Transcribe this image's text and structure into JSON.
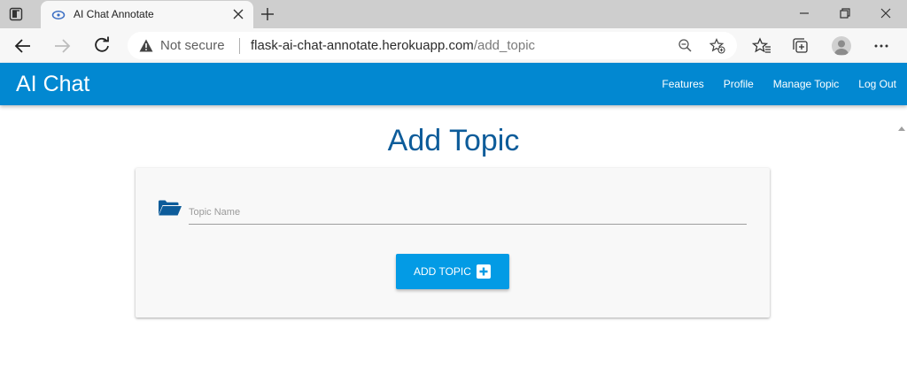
{
  "browser": {
    "tab": {
      "title": "AI Chat Annotate"
    },
    "address": {
      "security_label": "Not secure",
      "url_host": "flask-ai-chat-annotate.herokuapp.com",
      "url_path": "/add_topic"
    }
  },
  "header": {
    "brand": "AI Chat",
    "nav": [
      {
        "label": "Features"
      },
      {
        "label": "Profile"
      },
      {
        "label": "Manage Topic"
      },
      {
        "label": "Log Out"
      }
    ]
  },
  "main": {
    "title": "Add Topic",
    "form": {
      "topic_name": {
        "placeholder": "Topic Name",
        "value": ""
      },
      "submit_label": "ADD TOPIC"
    }
  },
  "colors": {
    "header": "#0288d1",
    "title": "#0d5c9a",
    "button": "#039be5",
    "folder_icon": "#0d5c9a"
  },
  "icons": {
    "tab_actions": "tab-actions-icon",
    "favicon": "chat-favicon-icon",
    "tab_close": "close-icon",
    "new_tab": "plus-icon",
    "minimize": "minimize-icon",
    "restore": "restore-icon",
    "close_window": "close-icon",
    "back": "back-arrow-icon",
    "forward": "forward-arrow-icon",
    "refresh": "refresh-icon",
    "warning": "warning-icon",
    "zoom": "zoom-out-icon",
    "add_favorite": "add-favorite-icon",
    "favorites": "favorites-icon",
    "collections": "collections-icon",
    "profile": "avatar-icon",
    "menu": "more-icon",
    "folder": "folder-open-icon",
    "add_box": "add-box-icon"
  }
}
